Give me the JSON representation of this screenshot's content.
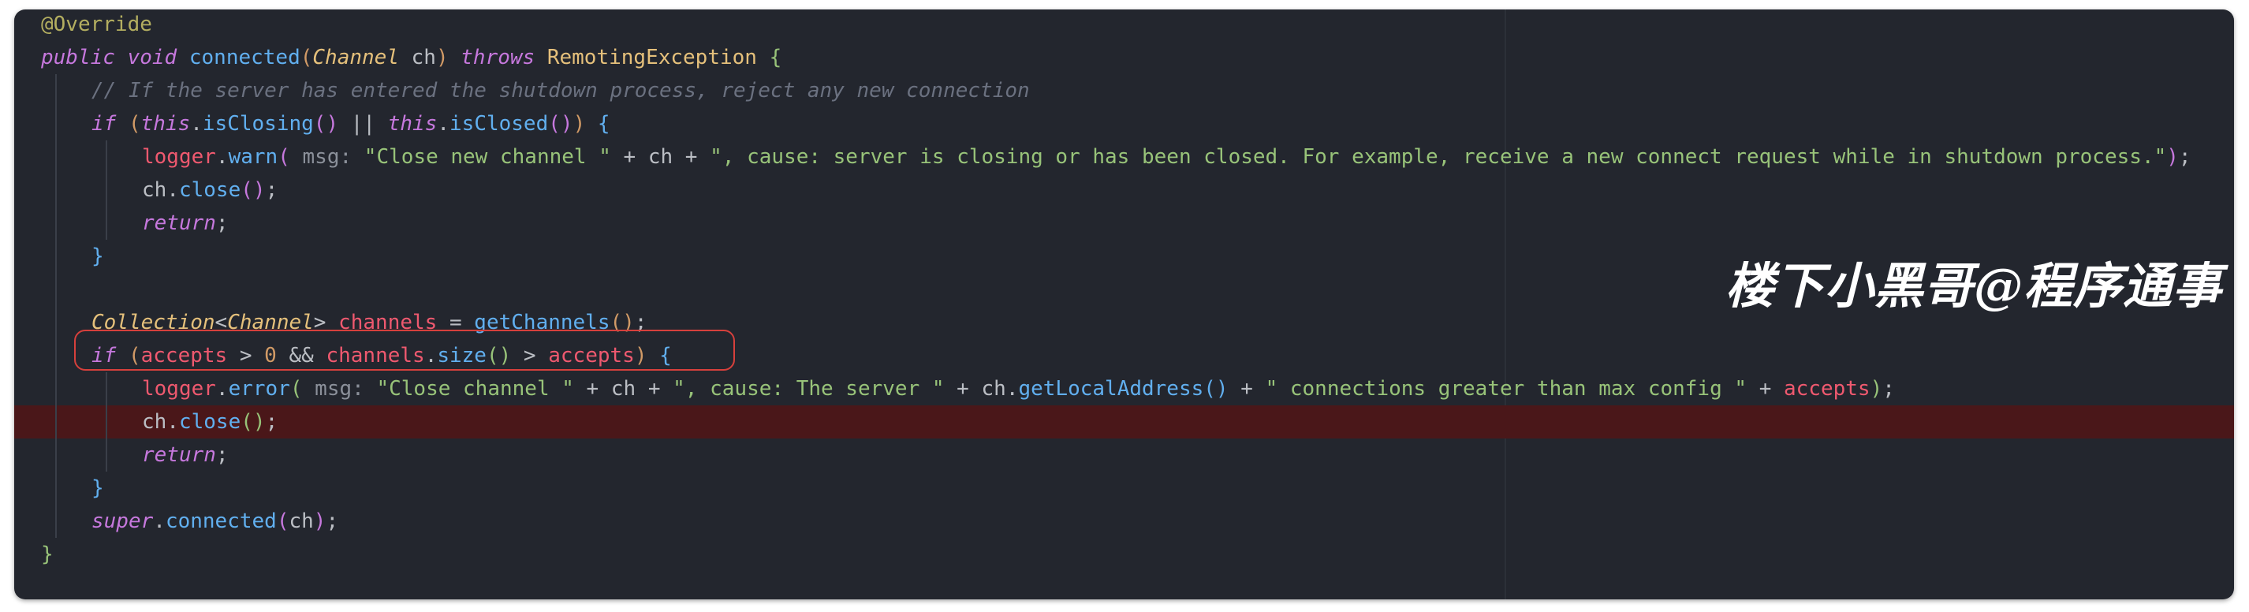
{
  "editor": {
    "background": "#23262e",
    "highlight_line_color": "#4a1719",
    "highlight_box_color": "#d6403c"
  },
  "code": {
    "l1": {
      "annotation": "@Override"
    },
    "l2": {
      "public": "public",
      "void": "void",
      "method": "connected",
      "type": "Channel",
      "param": "ch",
      "throws": "throws",
      "exception": "RemotingException"
    },
    "l3": {
      "comment": "// If the server has entered the shutdown process, reject any new connection"
    },
    "l4": {
      "if": "if",
      "this1": "this",
      "isClosing": "isClosing",
      "or": "||",
      "this2": "this",
      "isClosed": "isClosed"
    },
    "l5": {
      "logger": "logger",
      "warn": "warn",
      "hint": "msg:",
      "str1": "\"Close new channel \"",
      "ch": "ch",
      "str2": "\", cause: server is closing or has been closed. For example, receive a new connect request while in shutdown process.\""
    },
    "l6": {
      "ch": "ch",
      "close": "close"
    },
    "l7": {
      "return": "return"
    },
    "l9": {
      "type": "Collection",
      "generic": "Channel",
      "var": "channels",
      "call": "getChannels"
    },
    "l10": {
      "if": "if",
      "accepts1": "accepts",
      "zero": "0",
      "and": "&&",
      "channels": "channels",
      "size": "size",
      "accepts2": "accepts"
    },
    "l11": {
      "logger": "logger",
      "error": "error",
      "hint": "msg:",
      "str1": "\"Close channel \"",
      "ch1": "ch",
      "str2": "\", cause: The server \"",
      "ch2": "ch",
      "getLocal": "getLocalAddress",
      "str3": "\" connections greater than max config \"",
      "accepts": "accepts"
    },
    "l12": {
      "ch": "ch",
      "close": "close"
    },
    "l13": {
      "return": "return"
    },
    "l15": {
      "super": "super",
      "connected": "connected",
      "ch": "ch"
    }
  },
  "watermark": {
    "text": "楼下小黑哥@程序通事"
  }
}
